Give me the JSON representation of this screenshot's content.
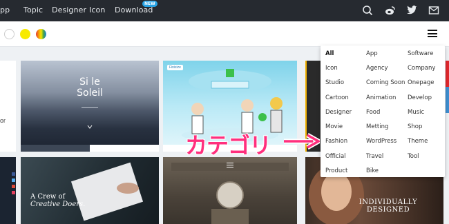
{
  "topbar": {
    "nav": [
      "pp",
      "Topic",
      "Designer",
      "Icon",
      "Download"
    ],
    "badge": "NEW",
    "icons": [
      "search-icon",
      "weibo-icon",
      "twitter-icon",
      "mail-icon"
    ]
  },
  "subbar": {
    "dots": [
      "#ffffff",
      "#f7ea00",
      "rainbow"
    ],
    "menu_icon": "hamburger-icon"
  },
  "cards": {
    "soleil_title_1": "Si le",
    "soleil_title_2": "Soleil",
    "finix_label": "Finixize",
    "creative_1": "A Crew of",
    "creative_2": "Creative Doers.",
    "indiv_1": "INDIVIDUALLY",
    "indiv_2": "DESIGNED",
    "left_edge": "or"
  },
  "dropdown": {
    "items": [
      [
        "All",
        "App",
        "Software"
      ],
      [
        "Icon",
        "Agency",
        "Company"
      ],
      [
        "Studio",
        "Coming Soon",
        "Onepage"
      ],
      [
        "Cartoon",
        "Animation",
        "Develop"
      ],
      [
        "Designer",
        "Food",
        "Music"
      ],
      [
        "Movie",
        "Metting",
        "Shop"
      ],
      [
        "Fashion",
        "WordPress",
        "Theme"
      ],
      [
        "Official",
        "Travel",
        "Tool"
      ],
      [
        "Product",
        "Bike",
        ""
      ]
    ]
  },
  "annotation": "カテゴリ",
  "colors": {
    "accent": "#ff2f7d",
    "topbar": "#262a30",
    "badge": "#27a3e5"
  }
}
